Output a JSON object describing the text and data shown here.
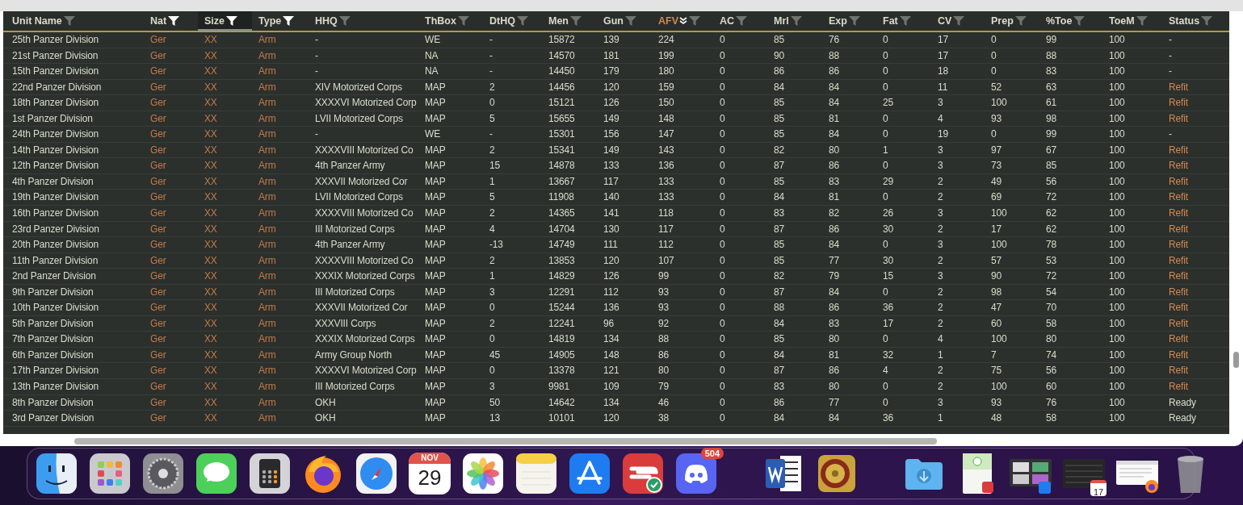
{
  "table": {
    "columns": [
      {
        "label": "Unit Name",
        "filtered": false,
        "selected": false,
        "sorted": false,
        "accent": false
      },
      {
        "label": "Nat",
        "filtered": true,
        "selected": false,
        "sorted": false,
        "accent": true
      },
      {
        "label": "Size",
        "filtered": true,
        "selected": true,
        "sorted": false,
        "accent": true
      },
      {
        "label": "Type",
        "filtered": true,
        "selected": false,
        "sorted": false,
        "accent": true
      },
      {
        "label": "HHQ",
        "filtered": false,
        "selected": false,
        "sorted": false,
        "accent": false
      },
      {
        "label": "ThBox",
        "filtered": false,
        "selected": false,
        "sorted": false,
        "accent": false
      },
      {
        "label": "DtHQ",
        "filtered": false,
        "selected": false,
        "sorted": false,
        "accent": false
      },
      {
        "label": "Men",
        "filtered": false,
        "selected": false,
        "sorted": false,
        "accent": false
      },
      {
        "label": "Gun",
        "filtered": false,
        "selected": false,
        "sorted": false,
        "accent": false
      },
      {
        "label": "AFV",
        "filtered": false,
        "selected": false,
        "sorted": true,
        "accent": false
      },
      {
        "label": "AC",
        "filtered": false,
        "selected": false,
        "sorted": false,
        "accent": false
      },
      {
        "label": "Mrl",
        "filtered": false,
        "selected": false,
        "sorted": false,
        "accent": false
      },
      {
        "label": "Exp",
        "filtered": false,
        "selected": false,
        "sorted": false,
        "accent": false
      },
      {
        "label": "Fat",
        "filtered": false,
        "selected": false,
        "sorted": false,
        "accent": false
      },
      {
        "label": "CV",
        "filtered": false,
        "selected": false,
        "sorted": false,
        "accent": false
      },
      {
        "label": "Prep",
        "filtered": false,
        "selected": false,
        "sorted": false,
        "accent": false
      },
      {
        "label": "%Toe",
        "filtered": false,
        "selected": false,
        "sorted": false,
        "accent": false
      },
      {
        "label": "ToeM",
        "filtered": false,
        "selected": false,
        "sorted": false,
        "accent": false
      },
      {
        "label": "Status",
        "filtered": false,
        "selected": false,
        "sorted": false,
        "accent": false
      }
    ],
    "rows": [
      {
        "cells": [
          "25th Panzer Division",
          "Ger",
          "XX",
          "Arm",
          "-",
          "WE",
          "-",
          "15872",
          "139",
          "224",
          "0",
          "85",
          "76",
          "0",
          "17",
          "0",
          "99",
          "100",
          "-"
        ],
        "status_highlighted": false
      },
      {
        "cells": [
          "21st Panzer Division",
          "Ger",
          "XX",
          "Arm",
          "-",
          "NA",
          "-",
          "14570",
          "181",
          "199",
          "0",
          "90",
          "88",
          "0",
          "17",
          "0",
          "88",
          "100",
          "-"
        ],
        "status_highlighted": false
      },
      {
        "cells": [
          "15th Panzer Division",
          "Ger",
          "XX",
          "Arm",
          "-",
          "NA",
          "-",
          "14450",
          "179",
          "180",
          "0",
          "86",
          "86",
          "0",
          "18",
          "0",
          "83",
          "100",
          "-"
        ],
        "status_highlighted": false
      },
      {
        "cells": [
          "22nd Panzer Division",
          "Ger",
          "XX",
          "Arm",
          "XIV Motorized Corps",
          "MAP",
          "2",
          "14456",
          "120",
          "159",
          "0",
          "84",
          "84",
          "0",
          "11",
          "52",
          "63",
          "100",
          "Refit"
        ],
        "status_highlighted": true
      },
      {
        "cells": [
          "18th Panzer Division",
          "Ger",
          "XX",
          "Arm",
          "XXXXVI Motorized Corp",
          "MAP",
          "0",
          "15121",
          "126",
          "150",
          "0",
          "85",
          "84",
          "25",
          "3",
          "100",
          "61",
          "100",
          "Refit"
        ],
        "status_highlighted": true
      },
      {
        "cells": [
          "1st Panzer Division",
          "Ger",
          "XX",
          "Arm",
          "LVII Motorized Corps",
          "MAP",
          "5",
          "15655",
          "149",
          "148",
          "0",
          "85",
          "81",
          "0",
          "4",
          "93",
          "98",
          "100",
          "Refit"
        ],
        "status_highlighted": true
      },
      {
        "cells": [
          "24th Panzer Division",
          "Ger",
          "XX",
          "Arm",
          "-",
          "WE",
          "-",
          "15301",
          "156",
          "147",
          "0",
          "85",
          "84",
          "0",
          "19",
          "0",
          "99",
          "100",
          "-"
        ],
        "status_highlighted": false
      },
      {
        "cells": [
          "14th Panzer Division",
          "Ger",
          "XX",
          "Arm",
          "XXXXVIII Motorized Co",
          "MAP",
          "2",
          "15341",
          "149",
          "143",
          "0",
          "82",
          "80",
          "1",
          "3",
          "97",
          "67",
          "100",
          "Refit"
        ],
        "status_highlighted": true
      },
      {
        "cells": [
          "12th Panzer Division",
          "Ger",
          "XX",
          "Arm",
          "4th Panzer Army",
          "MAP",
          "15",
          "14878",
          "133",
          "136",
          "0",
          "87",
          "86",
          "0",
          "3",
          "73",
          "85",
          "100",
          "Refit"
        ],
        "status_highlighted": true
      },
      {
        "cells": [
          "4th Panzer Division",
          "Ger",
          "XX",
          "Arm",
          "XXXVII Motorized Cor",
          "MAP",
          "1",
          "13667",
          "117",
          "133",
          "0",
          "85",
          "83",
          "29",
          "2",
          "49",
          "56",
          "100",
          "Refit"
        ],
        "status_highlighted": true
      },
      {
        "cells": [
          "19th Panzer Division",
          "Ger",
          "XX",
          "Arm",
          "LVII Motorized Corps",
          "MAP",
          "5",
          "11908",
          "140",
          "133",
          "0",
          "84",
          "81",
          "0",
          "2",
          "69",
          "72",
          "100",
          "Refit"
        ],
        "status_highlighted": true
      },
      {
        "cells": [
          "16th Panzer Division",
          "Ger",
          "XX",
          "Arm",
          "XXXXVIII Motorized Co",
          "MAP",
          "2",
          "14365",
          "141",
          "118",
          "0",
          "83",
          "82",
          "26",
          "3",
          "100",
          "62",
          "100",
          "Refit"
        ],
        "status_highlighted": true
      },
      {
        "cells": [
          "23rd Panzer Division",
          "Ger",
          "XX",
          "Arm",
          "III Motorized Corps",
          "MAP",
          "4",
          "14704",
          "130",
          "117",
          "0",
          "87",
          "86",
          "30",
          "2",
          "17",
          "62",
          "100",
          "Refit"
        ],
        "status_highlighted": true
      },
      {
        "cells": [
          "20th Panzer Division",
          "Ger",
          "XX",
          "Arm",
          "4th Panzer Army",
          "MAP",
          "-13",
          "14749",
          "111",
          "112",
          "0",
          "85",
          "84",
          "0",
          "3",
          "100",
          "78",
          "100",
          "Refit"
        ],
        "status_highlighted": true
      },
      {
        "cells": [
          "11th Panzer Division",
          "Ger",
          "XX",
          "Arm",
          "XXXXVIII Motorized Co",
          "MAP",
          "2",
          "13853",
          "120",
          "107",
          "0",
          "85",
          "77",
          "30",
          "2",
          "57",
          "53",
          "100",
          "Refit"
        ],
        "status_highlighted": true
      },
      {
        "cells": [
          "2nd Panzer Division",
          "Ger",
          "XX",
          "Arm",
          "XXXIX Motorized Corps",
          "MAP",
          "1",
          "14829",
          "126",
          "99",
          "0",
          "82",
          "79",
          "15",
          "3",
          "90",
          "72",
          "100",
          "Refit"
        ],
        "status_highlighted": true
      },
      {
        "cells": [
          "9th Panzer Division",
          "Ger",
          "XX",
          "Arm",
          "III Motorized Corps",
          "MAP",
          "3",
          "12291",
          "112",
          "93",
          "0",
          "87",
          "84",
          "0",
          "2",
          "98",
          "54",
          "100",
          "Refit"
        ],
        "status_highlighted": true
      },
      {
        "cells": [
          "10th Panzer Division",
          "Ger",
          "XX",
          "Arm",
          "XXXVII Motorized Cor",
          "MAP",
          "0",
          "15244",
          "136",
          "93",
          "0",
          "88",
          "86",
          "36",
          "2",
          "47",
          "70",
          "100",
          "Refit"
        ],
        "status_highlighted": true
      },
      {
        "cells": [
          "5th Panzer Division",
          "Ger",
          "XX",
          "Arm",
          "XXXVIII Corps",
          "MAP",
          "2",
          "12241",
          "96",
          "92",
          "0",
          "84",
          "83",
          "17",
          "2",
          "60",
          "58",
          "100",
          "Refit"
        ],
        "status_highlighted": true
      },
      {
        "cells": [
          "7th Panzer Division",
          "Ger",
          "XX",
          "Arm",
          "XXXIX Motorized Corps",
          "MAP",
          "0",
          "14819",
          "134",
          "88",
          "0",
          "85",
          "80",
          "0",
          "4",
          "100",
          "80",
          "100",
          "Refit"
        ],
        "status_highlighted": true
      },
      {
        "cells": [
          "6th Panzer Division",
          "Ger",
          "XX",
          "Arm",
          "Army Group North",
          "MAP",
          "45",
          "14905",
          "148",
          "86",
          "0",
          "84",
          "81",
          "32",
          "1",
          "7",
          "74",
          "100",
          "Refit"
        ],
        "status_highlighted": true
      },
      {
        "cells": [
          "17th Panzer Division",
          "Ger",
          "XX",
          "Arm",
          "XXXXVI Motorized Corp",
          "MAP",
          "0",
          "13378",
          "121",
          "80",
          "0",
          "87",
          "86",
          "4",
          "2",
          "75",
          "56",
          "100",
          "Refit"
        ],
        "status_highlighted": true
      },
      {
        "cells": [
          "13th Panzer Division",
          "Ger",
          "XX",
          "Arm",
          "III Motorized Corps",
          "MAP",
          "3",
          "9981",
          "109",
          "79",
          "0",
          "83",
          "80",
          "0",
          "2",
          "100",
          "60",
          "100",
          "Refit"
        ],
        "status_highlighted": true
      },
      {
        "cells": [
          "8th Panzer Division",
          "Ger",
          "XX",
          "Arm",
          "OKH",
          "MAP",
          "50",
          "14642",
          "134",
          "46",
          "0",
          "86",
          "77",
          "0",
          "3",
          "93",
          "76",
          "100",
          "Ready"
        ],
        "status_highlighted": false
      },
      {
        "cells": [
          "3rd Panzer Division",
          "Ger",
          "XX",
          "Arm",
          "OKH",
          "MAP",
          "13",
          "10101",
          "120",
          "38",
          "0",
          "84",
          "84",
          "36",
          "1",
          "48",
          "58",
          "100",
          "Ready"
        ],
        "status_highlighted": false
      }
    ]
  },
  "dock": {
    "items": [
      {
        "kind": "finder"
      },
      {
        "kind": "launchpad"
      },
      {
        "kind": "settings"
      },
      {
        "kind": "messages"
      },
      {
        "kind": "calculator"
      },
      {
        "kind": "firefox"
      },
      {
        "kind": "safari"
      },
      {
        "kind": "calendar",
        "month": "NOV",
        "day": "29"
      },
      {
        "kind": "photos"
      },
      {
        "kind": "notes"
      },
      {
        "kind": "appstore"
      },
      {
        "kind": "vpn"
      },
      {
        "kind": "discord",
        "badge": "504"
      },
      {
        "kind": "separator"
      },
      {
        "kind": "word"
      },
      {
        "kind": "vault"
      },
      {
        "kind": "separator"
      },
      {
        "kind": "folder"
      },
      {
        "kind": "thumb-vpn"
      },
      {
        "kind": "thumb-windows"
      },
      {
        "kind": "thumb-calendar",
        "day": "17"
      },
      {
        "kind": "thumb-browser"
      },
      {
        "kind": "trash"
      }
    ]
  }
}
